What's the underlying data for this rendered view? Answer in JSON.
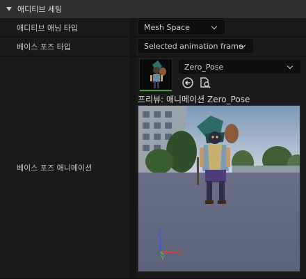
{
  "section": {
    "title": "애디티브 세팅"
  },
  "rows": {
    "additive_anim_type": {
      "label": "애디티브 애님 타입",
      "value": "Mesh Space"
    },
    "base_pose_type": {
      "label": "베이스 포즈 타입",
      "value": "Selected animation frame"
    },
    "base_pose_animation": {
      "label": "베이스 포즈 애니메이션",
      "asset_value": "Zero_Pose",
      "preview_label": "프리뷰: 애니메이션 Zero_Pose"
    }
  },
  "icons": {
    "use_selected": "arrow-left-circle-icon",
    "browse": "browse-asset-icon",
    "thumbnail": "animation-thumbnail"
  },
  "viewport": {
    "axis": {
      "x": "X",
      "y": "Y",
      "z": "Z"
    }
  },
  "colors": {
    "axis_x": "#e03a3a",
    "axis_y": "#3ac23a",
    "axis_z": "#3a5ae0",
    "thumbnail_bar": "#4c9a3e"
  }
}
